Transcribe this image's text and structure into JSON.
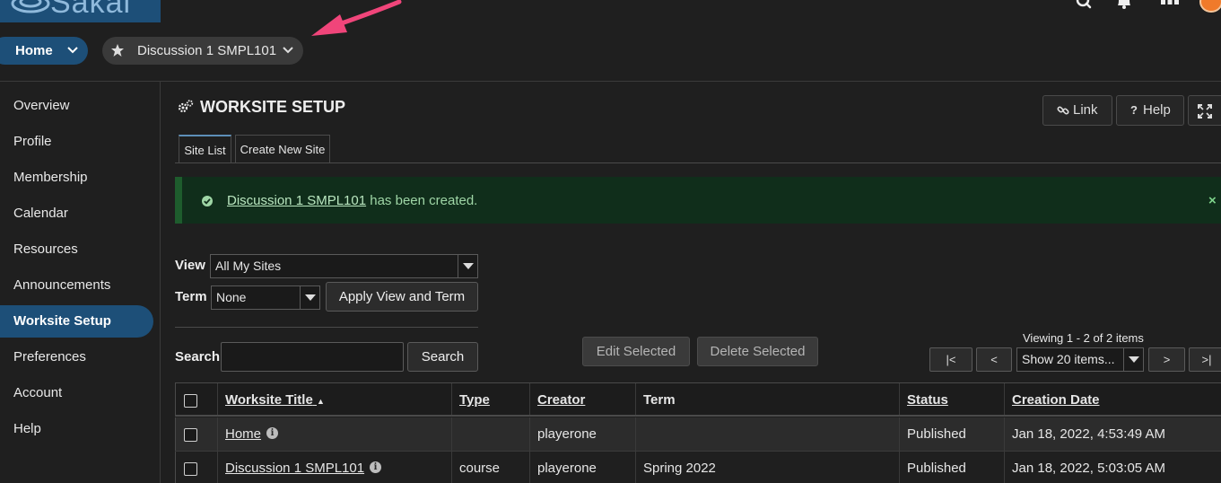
{
  "header": {
    "logo_text": "Sakai"
  },
  "nav": {
    "home_label": "Home",
    "site_label": "Discussion 1 SMPL101"
  },
  "sidebar": {
    "items": [
      {
        "label": "Overview"
      },
      {
        "label": "Profile"
      },
      {
        "label": "Membership"
      },
      {
        "label": "Calendar"
      },
      {
        "label": "Resources"
      },
      {
        "label": "Announcements"
      },
      {
        "label": "Worksite Setup"
      },
      {
        "label": "Preferences"
      },
      {
        "label": "Account"
      },
      {
        "label": "Help"
      }
    ],
    "active_item": "Worksite Setup"
  },
  "tool": {
    "title": "WORKSITE SETUP",
    "link_label": "Link",
    "help_label": "Help"
  },
  "tabs": [
    {
      "label": "Site List"
    },
    {
      "label": "Create New Site"
    }
  ],
  "alert": {
    "site_link": "Discussion 1 SMPL101",
    "message": " has been created.",
    "close_glyph": "×"
  },
  "filters": {
    "view_label": "View",
    "view_value": "All My Sites",
    "term_label": "Term",
    "term_value": "None",
    "apply_label": "Apply View and Term",
    "search_label": "Search",
    "search_value": "",
    "search_button": "Search"
  },
  "actions": {
    "edit_selected": "Edit Selected",
    "delete_selected": "Delete Selected"
  },
  "pager": {
    "viewing_text": "Viewing 1 - 2 of 2 items",
    "first": "|<",
    "prev": "<",
    "page_size": "Show 20 items...",
    "next": ">",
    "last": ">|"
  },
  "table": {
    "columns": [
      "Worksite Title",
      "Type",
      "Creator",
      "Term",
      "Status",
      "Creation Date"
    ],
    "sort_indicator": "▲",
    "rows": [
      {
        "title": "Home",
        "type": "",
        "creator": "playerone",
        "term": "",
        "status": "Published",
        "created": "Jan 18, 2022, 4:53:49 AM"
      },
      {
        "title": "Discussion 1 SMPL101",
        "type": "course",
        "creator": "playerone",
        "term": "Spring 2022",
        "status": "Published",
        "created": "Jan 18, 2022, 5:03:05 AM"
      }
    ]
  },
  "colors": {
    "brand": "#1d4f78",
    "annotation_arrow": "#f0457a",
    "success_bg": "#102e1b"
  }
}
